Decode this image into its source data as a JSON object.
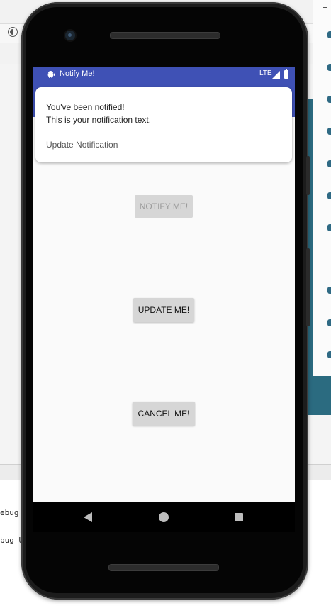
{
  "desktop": {
    "console_lines": [
      "ebug",
      "bug U"
    ]
  },
  "status_bar": {
    "app_name": "Notify Me!",
    "network": "LTE"
  },
  "notification": {
    "title": "You've been notified!",
    "text": "This is your notification text.",
    "action_label": "Update Notification"
  },
  "buttons": {
    "notify": "NOTIFY ME!",
    "update": "UPDATE ME!",
    "cancel": "CANCEL ME!"
  },
  "icons": {
    "app": "android-icon",
    "signal": "signal-icon",
    "battery": "battery-icon",
    "back": "nav-back-icon",
    "home": "nav-home-icon",
    "recents": "nav-recents-icon"
  },
  "colors": {
    "primary": "#3f51b5",
    "screen_bg": "#fafafa",
    "button_bg": "#d6d6d6",
    "teal": "#2b6b80"
  }
}
